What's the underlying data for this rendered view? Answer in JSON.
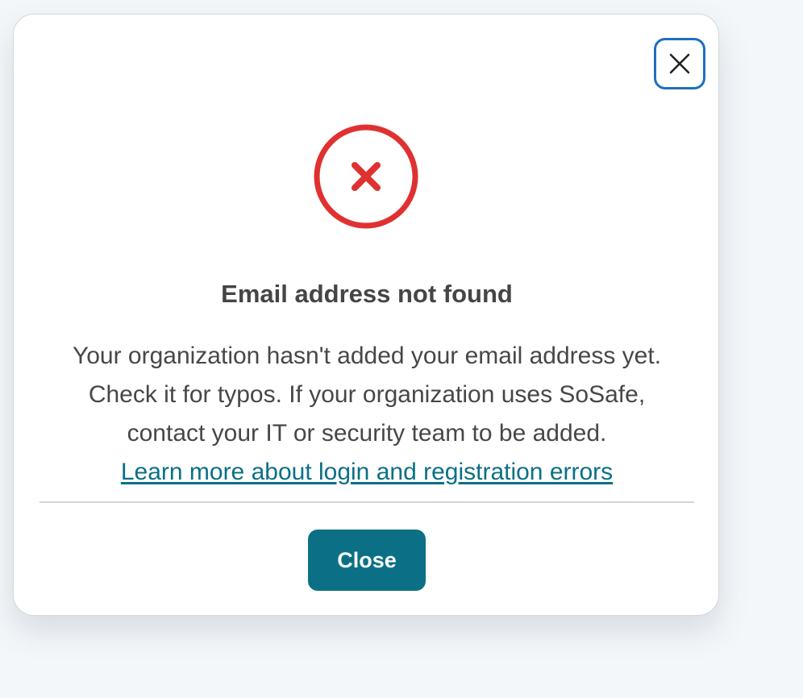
{
  "dialog": {
    "title": "Email address not found",
    "message_lines": [
      "Your organization hasn't added your email address yet.",
      "Check it for typos. If your organization uses SoSafe,",
      "contact your IT or security team to be added."
    ],
    "help_link": "Learn more about login and registration errors",
    "close_button_label": "Close",
    "close_icon": "close-icon",
    "status_icon": "error-circle-icon"
  },
  "colors": {
    "accent": "#0b7085",
    "error": "#e03131",
    "focus_ring": "#1f6fc1",
    "text": "#474747",
    "background": "#f4f7fa"
  }
}
